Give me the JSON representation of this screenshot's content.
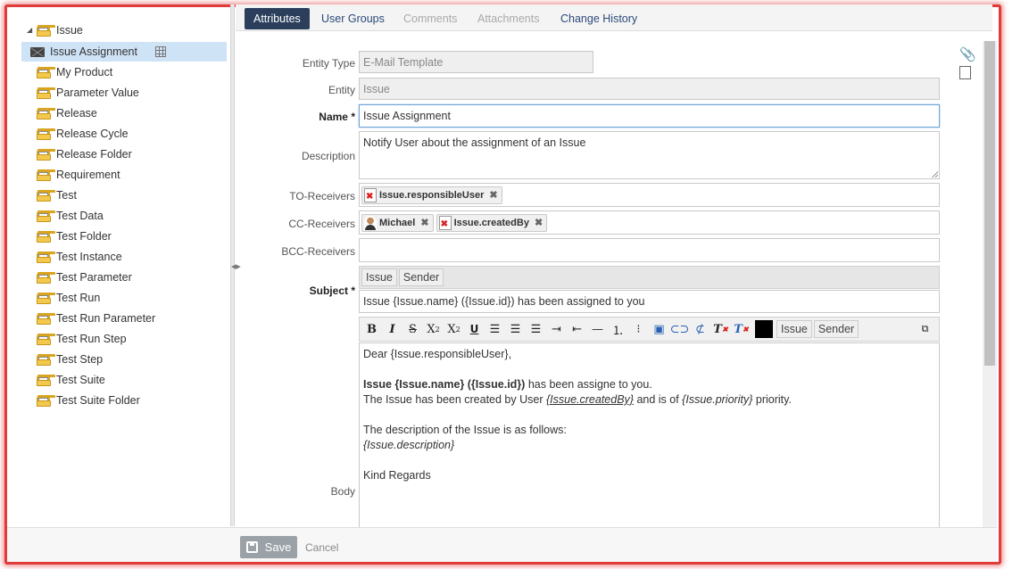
{
  "tree": {
    "root": "Issue",
    "selected": "Issue Assignment",
    "items": [
      "My Product",
      "Parameter Value",
      "Release",
      "Release Cycle",
      "Release Folder",
      "Requirement",
      "Test",
      "Test Data",
      "Test Folder",
      "Test Instance",
      "Test Parameter",
      "Test Run",
      "Test Run Parameter",
      "Test Run Step",
      "Test Step",
      "Test Suite",
      "Test Suite Folder"
    ]
  },
  "tabs": [
    "Attributes",
    "User Groups",
    "Comments",
    "Attachments",
    "Change History"
  ],
  "form": {
    "entity_type_label": "Entity Type",
    "entity_type": "E-Mail Template",
    "entity_label": "Entity",
    "entity": "Issue",
    "name_label": "Name",
    "name": "Issue Assignment",
    "description_label": "Description",
    "description": "Notify User about the assignment of an Issue",
    "to_label": "TO-Receivers",
    "to": [
      {
        "label": "Issue.responsibleUser",
        "icon": "document-error-icon"
      }
    ],
    "cc_label": "CC-Receivers",
    "cc": [
      {
        "label": "Michael",
        "icon": "user-icon"
      },
      {
        "label": "Issue.createdBy",
        "icon": "document-error-icon"
      }
    ],
    "bcc_label": "BCC-Receivers",
    "subject_label": "Subject",
    "subject_buttons": [
      "Issue",
      "Sender"
    ],
    "subject": "Issue {Issue.name} ({Issue.id}) has been assigned to you",
    "body_label": "Body",
    "body_buttons": [
      "Issue",
      "Sender"
    ],
    "body": {
      "greeting": "Dear {Issue.responsibleUser},",
      "line2_bold": "Issue {Issue.name} ({Issue.id})",
      "line2_rest": " has been assigne to you.",
      "line3_a": "The Issue has been created by User ",
      "line3_ph1": "{Issue.createdBy}",
      "line3_b": " and is of ",
      "line3_ph2": "{Issue.priority}",
      "line3_c": " priority.",
      "line4": "The description of the Issue is as follows:",
      "line5": "{Issue.description}",
      "closing": "Kind Regards"
    }
  },
  "footer": {
    "save": "Save",
    "cancel": "Cancel"
  },
  "colors": {
    "active_tab": "#2b3f5c",
    "frame": "#e03a3a",
    "selection": "#cfe3f6"
  }
}
